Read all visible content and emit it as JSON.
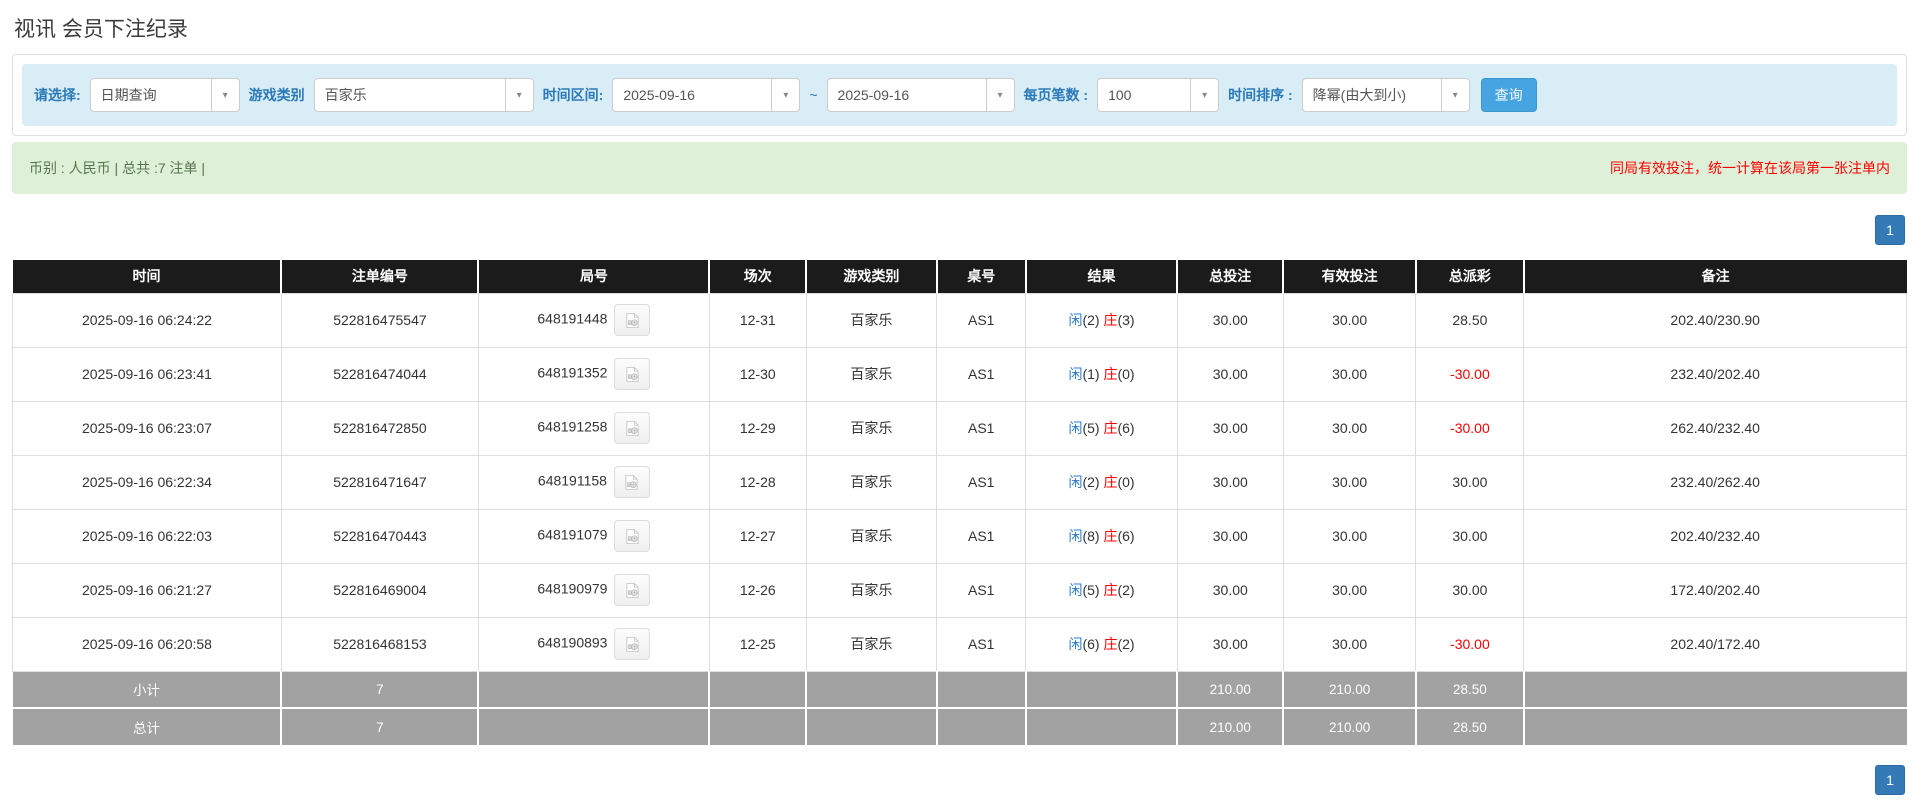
{
  "page": {
    "title": "视讯 会员下注纪录"
  },
  "filters": {
    "select_label": "请选择:",
    "select_value": "日期查询",
    "game_type_label": "游戏类别",
    "game_type_value": "百家乐",
    "time_range_label": "时间区间:",
    "date_from": "2025-09-16",
    "date_separator": "~",
    "date_to": "2025-09-16",
    "page_size_label": "每页笔数 :",
    "page_size_value": "100",
    "sort_label": "时间排序 :",
    "sort_value": "降幂(由大到小)",
    "search_button": "查询"
  },
  "summary": {
    "left_text": "币别 : 人民币 | 总共 :7 注单 |",
    "right_note": "同局有效投注，统一计算在该局第一张注单内"
  },
  "pagination": {
    "page": "1"
  },
  "icons": {
    "combo_arrow": "dropdown-arrow-icon",
    "round_video": "video-record-icon"
  },
  "colors": {
    "accent_blue": "#2a7ab9",
    "link_blue": "#2b7cd3",
    "search_button": "#46a5e0",
    "pager_blue": "#337ab7",
    "filter_bg": "#d9edf7",
    "summary_bg": "#dff0d8",
    "header_bg": "#1b1b1b",
    "footer_bg": "#a2a2a2",
    "negative_red": "#ff0000"
  },
  "table": {
    "headers": [
      "时间",
      "注单编号",
      "局号",
      "场次",
      "游戏类别",
      "桌号",
      "结果",
      "总投注",
      "有效投注",
      "总派彩",
      "备注"
    ],
    "rows": [
      {
        "time": "2025-09-16 06:24:22",
        "bet_id": "522816475547",
        "round_id": "648191448",
        "session": "12-31",
        "game": "百家乐",
        "table": "AS1",
        "player_label": "闲",
        "player_value": "(2)",
        "banker_label": "庄",
        "banker_value": "(3)",
        "total_bet": "30.00",
        "valid_bet": "30.00",
        "payout": "28.50",
        "remark": "202.40/230.90"
      },
      {
        "time": "2025-09-16 06:23:41",
        "bet_id": "522816474044",
        "round_id": "648191352",
        "session": "12-30",
        "game": "百家乐",
        "table": "AS1",
        "player_label": "闲",
        "player_value": "(1)",
        "banker_label": "庄",
        "banker_value": "(0)",
        "total_bet": "30.00",
        "valid_bet": "30.00",
        "payout": "-30.00",
        "remark": "232.40/202.40"
      },
      {
        "time": "2025-09-16 06:23:07",
        "bet_id": "522816472850",
        "round_id": "648191258",
        "session": "12-29",
        "game": "百家乐",
        "table": "AS1",
        "player_label": "闲",
        "player_value": "(5)",
        "banker_label": "庄",
        "banker_value": "(6)",
        "total_bet": "30.00",
        "valid_bet": "30.00",
        "payout": "-30.00",
        "remark": "262.40/232.40"
      },
      {
        "time": "2025-09-16 06:22:34",
        "bet_id": "522816471647",
        "round_id": "648191158",
        "session": "12-28",
        "game": "百家乐",
        "table": "AS1",
        "player_label": "闲",
        "player_value": "(2)",
        "banker_label": "庄",
        "banker_value": "(0)",
        "total_bet": "30.00",
        "valid_bet": "30.00",
        "payout": "30.00",
        "remark": "232.40/262.40"
      },
      {
        "time": "2025-09-16 06:22:03",
        "bet_id": "522816470443",
        "round_id": "648191079",
        "session": "12-27",
        "game": "百家乐",
        "table": "AS1",
        "player_label": "闲",
        "player_value": "(8)",
        "banker_label": "庄",
        "banker_value": "(6)",
        "total_bet": "30.00",
        "valid_bet": "30.00",
        "payout": "30.00",
        "remark": "202.40/232.40"
      },
      {
        "time": "2025-09-16 06:21:27",
        "bet_id": "522816469004",
        "round_id": "648190979",
        "session": "12-26",
        "game": "百家乐",
        "table": "AS1",
        "player_label": "闲",
        "player_value": "(5)",
        "banker_label": "庄",
        "banker_value": "(2)",
        "total_bet": "30.00",
        "valid_bet": "30.00",
        "payout": "30.00",
        "remark": "172.40/202.40"
      },
      {
        "time": "2025-09-16 06:20:58",
        "bet_id": "522816468153",
        "round_id": "648190893",
        "session": "12-25",
        "game": "百家乐",
        "table": "AS1",
        "player_label": "闲",
        "player_value": "(6)",
        "banker_label": "庄",
        "banker_value": "(2)",
        "total_bet": "30.00",
        "valid_bet": "30.00",
        "payout": "-30.00",
        "remark": "202.40/172.40"
      }
    ],
    "footer": [
      {
        "label": "小计",
        "count": "7",
        "total_bet": "210.00",
        "valid_bet": "210.00",
        "payout": "28.50"
      },
      {
        "label": "总计",
        "count": "7",
        "total_bet": "210.00",
        "valid_bet": "210.00",
        "payout": "28.50"
      }
    ]
  }
}
